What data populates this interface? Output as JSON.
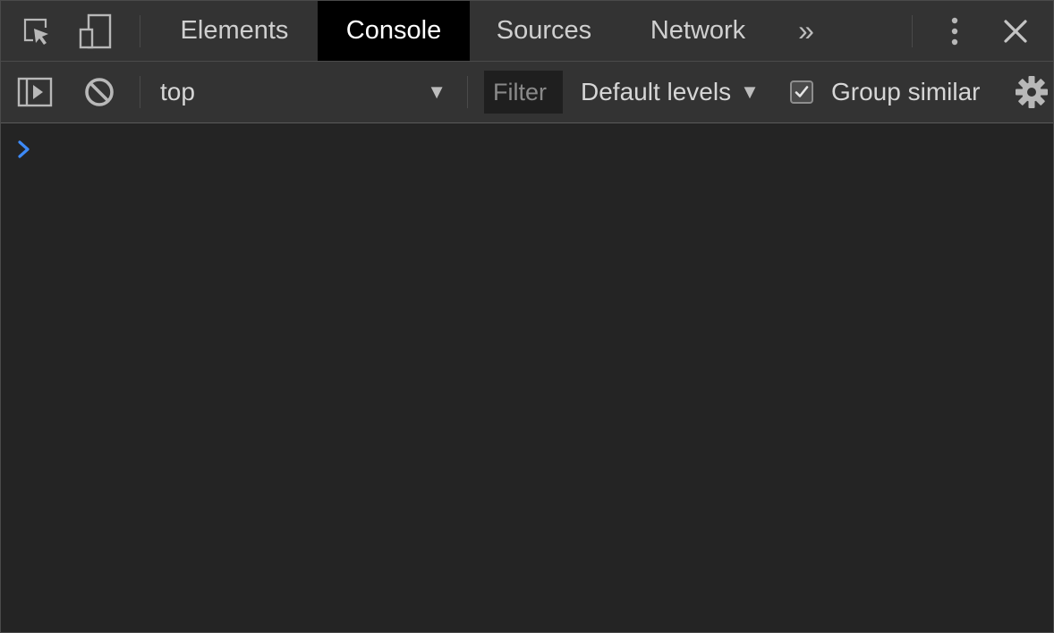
{
  "tabs": [
    {
      "label": "Elements",
      "active": false
    },
    {
      "label": "Console",
      "active": true
    },
    {
      "label": "Sources",
      "active": false
    },
    {
      "label": "Network",
      "active": false
    }
  ],
  "more_tabs_label": "»",
  "toolbar": {
    "context": "top",
    "filter_placeholder": "Filter",
    "levels_label": "Default levels",
    "group_similar_label": "Group similar",
    "group_similar_checked": true
  },
  "colors": {
    "background": "#242424",
    "toolbar": "#333333",
    "active_tab": "#000000",
    "prompt": "#3d8af7"
  },
  "icons": {
    "inspect": "inspect-element-icon",
    "device": "device-toolbar-icon",
    "more": "kebab-menu-icon",
    "close": "close-icon",
    "sidebar": "show-sidebar-icon",
    "clear": "clear-console-icon",
    "settings": "gear-icon",
    "prompt": "chevron-right-icon"
  }
}
